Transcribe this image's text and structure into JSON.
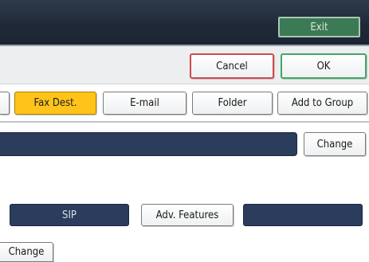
{
  "header": {
    "exit_label": "Exit"
  },
  "actions": {
    "cancel_label": "Cancel",
    "ok_label": "OK"
  },
  "tabs": [
    {
      "label": "Fax Dest.",
      "selected": true
    },
    {
      "label": "E-mail",
      "selected": false
    },
    {
      "label": "Folder",
      "selected": false
    },
    {
      "label": "Add to Group",
      "selected": false
    }
  ],
  "registration": {
    "change_label": "Change"
  },
  "options": {
    "sip_label": "SIP",
    "adv_features_label": "Adv. Features",
    "change_label": "Change"
  },
  "colors": {
    "selected_tab": "#ffc31a",
    "exit_button": "#3c7a55",
    "cancel_border": "#cf4b4b",
    "ok_border": "#3fa866",
    "dark_field": "#2b3c5c"
  }
}
